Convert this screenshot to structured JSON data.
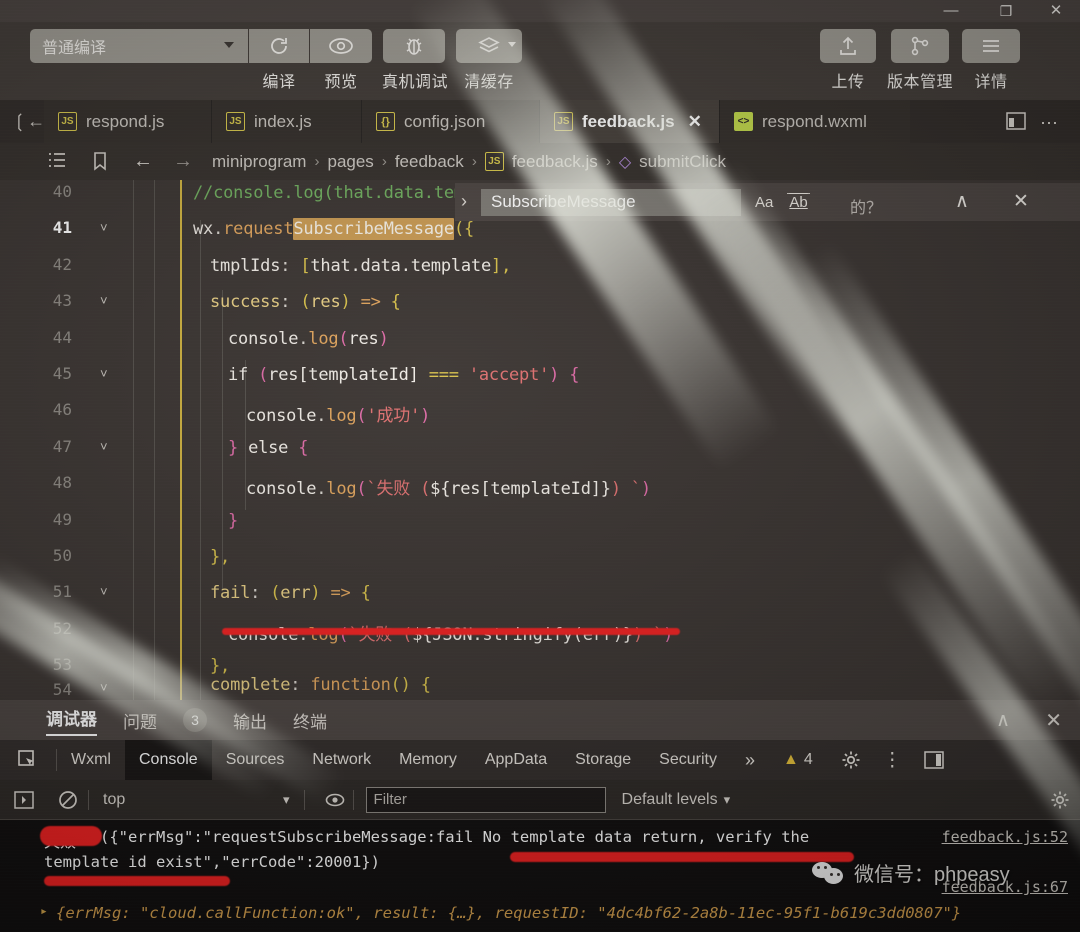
{
  "window": {
    "minimize": "—",
    "restore": "❐",
    "close": "✕"
  },
  "toolbar": {
    "compile_mode": "普通编译",
    "buttons": [
      {
        "label": "编译",
        "icon": "refresh-icon"
      },
      {
        "label": "预览",
        "icon": "eye-icon"
      },
      {
        "label": "真机调试",
        "icon": "bug-icon"
      },
      {
        "label": "清缓存",
        "icon": "layers-icon"
      }
    ],
    "right_buttons": [
      {
        "label": "上传",
        "icon": "upload-icon"
      },
      {
        "label": "版本管理",
        "icon": "branch-icon"
      },
      {
        "label": "详情",
        "icon": "menu-icon"
      }
    ]
  },
  "editor_tabs": [
    {
      "name": "respond.js",
      "type": "js",
      "active": false,
      "closable": false
    },
    {
      "name": "index.js",
      "type": "js",
      "active": false,
      "closable": false
    },
    {
      "name": "config.json",
      "type": "json",
      "active": false,
      "closable": false
    },
    {
      "name": "feedback.js",
      "type": "js",
      "active": true,
      "closable": true
    },
    {
      "name": "respond.wxml",
      "type": "wxml",
      "active": false,
      "closable": false
    }
  ],
  "breadcrumb": {
    "items": [
      "miniprogram",
      "pages",
      "feedback",
      "feedback.js",
      "submitClick"
    ],
    "separator": "›",
    "nav_back": "←",
    "nav_forward": "→"
  },
  "find_widget": {
    "query": "SubscribeMessage",
    "match_case": "Aa",
    "whole_word": "Ab",
    "regex": "·*",
    "prev": "∧",
    "close": "✕",
    "partial_overlay": "的？"
  },
  "code": {
    "lines": [
      {
        "num": "40",
        "chevron": false,
        "current": false,
        "indent": 0,
        "text": "//console.log(that.data.tem"
      },
      {
        "num": "41",
        "chevron": true,
        "current": true,
        "indent": 0,
        "text": "wx.requestSubscribeMessage({"
      },
      {
        "num": "42",
        "chevron": false,
        "current": false,
        "indent": 1,
        "text": "tmplIds: [that.data.template],"
      },
      {
        "num": "43",
        "chevron": true,
        "current": false,
        "indent": 1,
        "text": "success: (res) => {"
      },
      {
        "num": "44",
        "chevron": false,
        "current": false,
        "indent": 2,
        "text": "console.log(res)"
      },
      {
        "num": "45",
        "chevron": true,
        "current": false,
        "indent": 2,
        "text": "if (res[templateId] === 'accept') {"
      },
      {
        "num": "46",
        "chevron": false,
        "current": false,
        "indent": 3,
        "text": "console.log('成功')"
      },
      {
        "num": "47",
        "chevron": true,
        "current": false,
        "indent": 2,
        "text": "} else {"
      },
      {
        "num": "48",
        "chevron": false,
        "current": false,
        "indent": 3,
        "text": "console.log(`失败 (${res[templateId]}) `)"
      },
      {
        "num": "49",
        "chevron": false,
        "current": false,
        "indent": 2,
        "text": "}"
      },
      {
        "num": "50",
        "chevron": false,
        "current": false,
        "indent": 1,
        "text": "},"
      },
      {
        "num": "51",
        "chevron": true,
        "current": false,
        "indent": 1,
        "text": "fail: (err) => {"
      },
      {
        "num": "52",
        "chevron": false,
        "current": false,
        "indent": 2,
        "text": "console.log(`失败 (${JSON.stringify(err)}) `)"
      },
      {
        "num": "53",
        "chevron": false,
        "current": false,
        "indent": 1,
        "text": "},"
      },
      {
        "num": "54",
        "chevron": true,
        "current": false,
        "indent": 1,
        "text": "complete: function() {"
      }
    ]
  },
  "debugger": {
    "tabs": [
      {
        "label": "调试器",
        "active": true,
        "badge": null
      },
      {
        "label": "问题",
        "active": false,
        "badge": "3"
      },
      {
        "label": "输出",
        "active": false,
        "badge": null
      },
      {
        "label": "终端",
        "active": false,
        "badge": null
      }
    ],
    "collapse": "∧",
    "close": "✕"
  },
  "devtools": {
    "tabs": [
      "Wxml",
      "Console",
      "Sources",
      "Network",
      "Memory",
      "AppData",
      "Storage",
      "Security"
    ],
    "active_tab": "Console",
    "overflow": "»",
    "warning_count": "4",
    "inspect_icon": "inspect-element-icon",
    "settings_icon": "gear-icon",
    "more_icon": "kebab-menu-icon",
    "dock_icon": "dock-panel-icon"
  },
  "console_toolbar": {
    "sidebar_toggle": "sidebar-toggle-icon",
    "clear": "clear-console-icon",
    "context": "top",
    "context_caret": "▾",
    "eye": "live-expression-icon",
    "filter_placeholder": "Filter",
    "filter_value": "",
    "levels": "Default levels",
    "levels_caret": "▾",
    "settings": "gear-icon"
  },
  "console_output": {
    "error_prefix": "失败",
    "error_line1": "({\"errMsg\":\"requestSubscribeMessage:fail No template data return, verify the",
    "error_line2": "template id exist\",\"errCode\":20001})",
    "error_source": "feedback.js:52",
    "log_source": "feedback.js:67",
    "log_arrow": "▸",
    "log_text": "{errMsg: \"cloud.callFunction:ok\", result: {…}, requestID: \"4dc4bf62-2a8b-11ec-95f1-b619c3dd0807\"}"
  },
  "watermark": {
    "text": "微信号：phpeasy",
    "icon": "wechat-logo"
  },
  "colors": {
    "accent_yellow": "#d7c84a",
    "error_red": "#f02020",
    "highlight_orange": "#c99a52",
    "console_bg": "#100e0e"
  }
}
